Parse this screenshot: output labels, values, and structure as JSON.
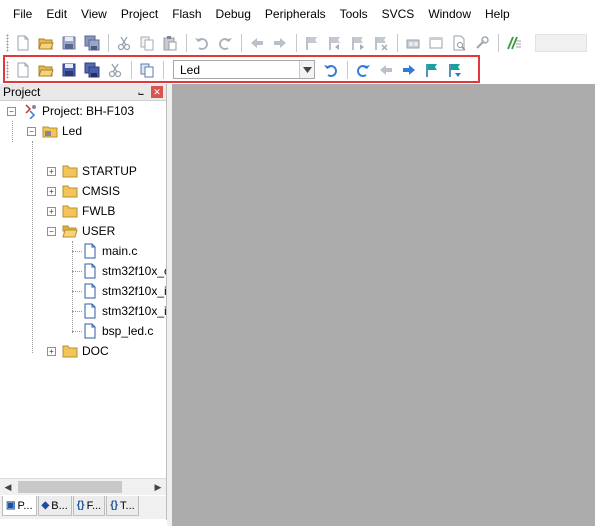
{
  "menu": [
    "File",
    "Edit",
    "View",
    "Project",
    "Flash",
    "Debug",
    "Peripherals",
    "Tools",
    "SVCS",
    "Window",
    "Help"
  ],
  "toolbar_build": {
    "target_value": "Led",
    "icons": [
      "new-file-icon",
      "open-folder-icon",
      "save-icon",
      "save-all-icon",
      "cut-icon",
      "copy-icon",
      "undo-icon",
      "redo-icon",
      "nav-back-icon",
      "nav-forward-icon",
      "insert-bookmark-icon",
      "prev-bookmark-icon",
      "next-bookmark-icon",
      "clear-bookmarks-icon",
      "find-icon",
      "search-files-icon",
      "configure-icon",
      "comment-icon"
    ]
  },
  "project_panel": {
    "title": "Project",
    "pin_glyph": "⨽",
    "close_glyph": "✕",
    "tree": {
      "project": "Project: BH-F103",
      "target": "Led",
      "groups": [
        "STARTUP",
        "CMSIS",
        "FWLB",
        "USER",
        "DOC"
      ],
      "user_files": [
        "main.c",
        "stm32f10x_c",
        "stm32f10x_i",
        "stm32f10x_i",
        "bsp_led.c"
      ]
    }
  },
  "tabs": [
    {
      "icon": "▣",
      "label": "P..."
    },
    {
      "icon": "◆",
      "label": "B..."
    },
    {
      "icon": "{}",
      "label": "F..."
    },
    {
      "icon": "{}",
      "label": "T..."
    }
  ],
  "colors": {
    "highlight": "#e2383b",
    "editor_bg": "#acacac",
    "folder": "#f2c45a",
    "blue_arrow": "#2f7bd6",
    "teal_flag": "#1aa0a0"
  }
}
